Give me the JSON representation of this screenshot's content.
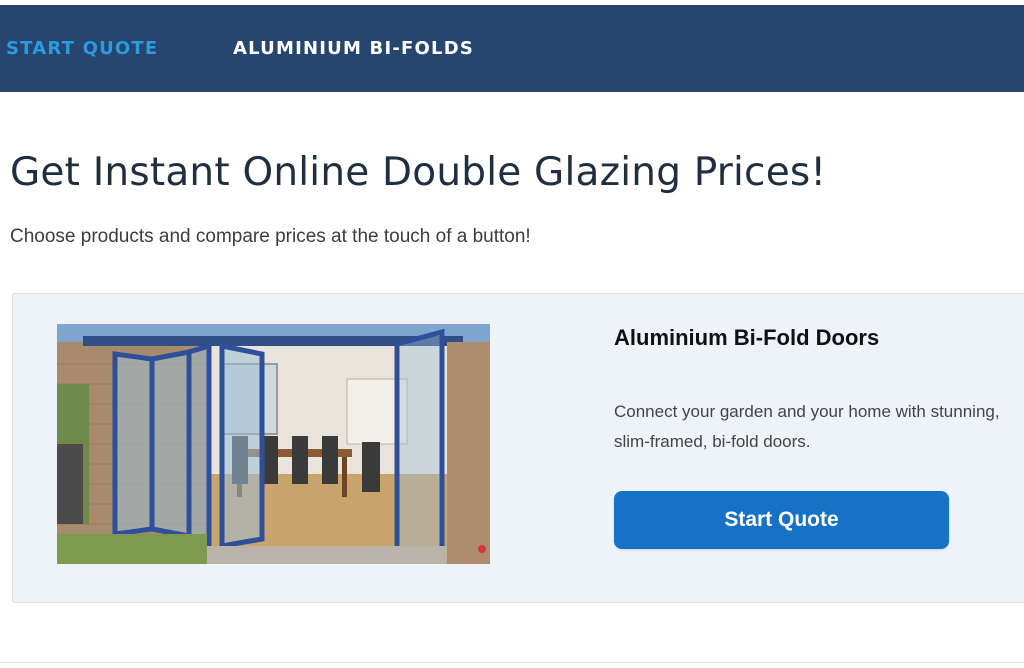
{
  "nav": {
    "start_quote": "START QUOTE",
    "aluminium_bifolds": "ALUMINIUM BI-FOLDS"
  },
  "header": {
    "title": "Get Instant Online Double Glazing Prices!",
    "subtitle": "Choose products and compare prices at the touch of a button!"
  },
  "product": {
    "title": "Aluminium Bi-Fold Doors",
    "description": "Connect your garden and your home with stunning, slim-framed, bi-fold doors.",
    "button_label": "Start Quote"
  },
  "colors": {
    "navbar_bg": "#26466f",
    "nav_active": "#2a9be0",
    "nav_text": "#ffffff",
    "card_bg": "#eef3f8",
    "button_bg": "#1572c4"
  }
}
